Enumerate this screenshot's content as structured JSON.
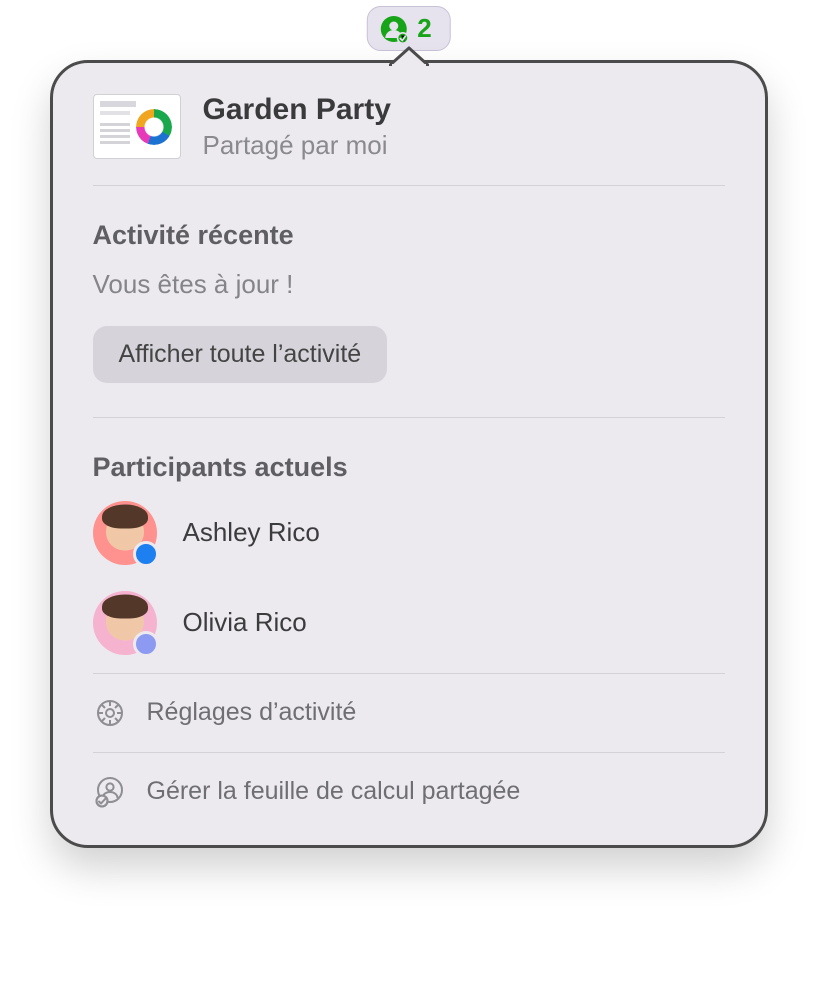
{
  "collab_button": {
    "count": "2",
    "icon_color": "#18a418"
  },
  "document": {
    "title": "Garden Party",
    "shared_by": "Partagé par moi"
  },
  "recent_activity": {
    "heading": "Activité récente",
    "status": "Vous êtes à jour !",
    "show_all_label": "Afficher toute l’activité"
  },
  "participants": {
    "heading": "Participants actuels",
    "list": [
      {
        "name": "Ashley Rico",
        "presence_color": "#1d7ff0"
      },
      {
        "name": "Olivia Rico",
        "presence_color": "#8d9af1"
      }
    ]
  },
  "footer": {
    "activity_settings": "Réglages d’activité",
    "manage_shared_spreadsheet": "Gérer la feuille de calcul partagée"
  }
}
